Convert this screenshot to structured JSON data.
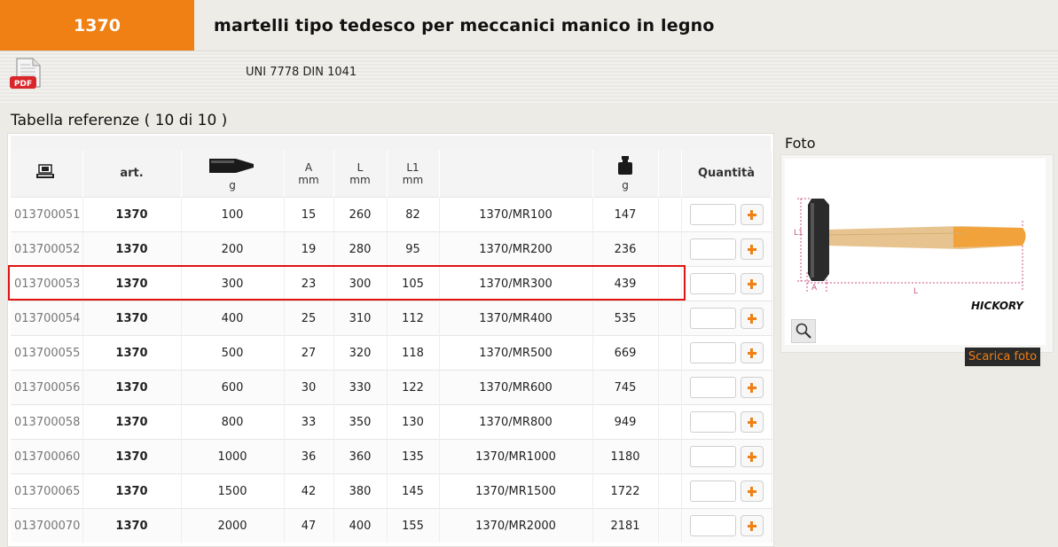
{
  "header": {
    "code": "1370",
    "title": "martelli tipo tedesco per meccanici manico in legno"
  },
  "subbar": {
    "pdf_icon": "pdf-icon",
    "norm": "UNI 7778 DIN 1041"
  },
  "table": {
    "title": "Tabella referenze ( 10 di 10 )",
    "headers": {
      "art": "art.",
      "weight_unit": "g",
      "a": "A",
      "a_unit": "mm",
      "l": "L",
      "l_unit": "mm",
      "l1": "L1",
      "l1_unit": "mm",
      "mass_unit": "g",
      "qty": "Quantità"
    },
    "rows": [
      {
        "code": "013700051",
        "art": "1370",
        "weight": "100",
        "a": "15",
        "l": "260",
        "l1": "82",
        "ref": "1370/MR100",
        "mass": "147"
      },
      {
        "code": "013700052",
        "art": "1370",
        "weight": "200",
        "a": "19",
        "l": "280",
        "l1": "95",
        "ref": "1370/MR200",
        "mass": "236"
      },
      {
        "code": "013700053",
        "art": "1370",
        "weight": "300",
        "a": "23",
        "l": "300",
        "l1": "105",
        "ref": "1370/MR300",
        "mass": "439"
      },
      {
        "code": "013700054",
        "art": "1370",
        "weight": "400",
        "a": "25",
        "l": "310",
        "l1": "112",
        "ref": "1370/MR400",
        "mass": "535"
      },
      {
        "code": "013700055",
        "art": "1370",
        "weight": "500",
        "a": "27",
        "l": "320",
        "l1": "118",
        "ref": "1370/MR500",
        "mass": "669"
      },
      {
        "code": "013700056",
        "art": "1370",
        "weight": "600",
        "a": "30",
        "l": "330",
        "l1": "122",
        "ref": "1370/MR600",
        "mass": "745"
      },
      {
        "code": "013700058",
        "art": "1370",
        "weight": "800",
        "a": "33",
        "l": "350",
        "l1": "130",
        "ref": "1370/MR800",
        "mass": "949"
      },
      {
        "code": "013700060",
        "art": "1370",
        "weight": "1000",
        "a": "36",
        "l": "360",
        "l1": "135",
        "ref": "1370/MR1000",
        "mass": "1180"
      },
      {
        "code": "013700065",
        "art": "1370",
        "weight": "1500",
        "a": "42",
        "l": "380",
        "l1": "145",
        "ref": "1370/MR1500",
        "mass": "1722"
      },
      {
        "code": "013700070",
        "art": "1370",
        "weight": "2000",
        "a": "47",
        "l": "400",
        "l1": "155",
        "ref": "1370/MR2000",
        "mass": "2181"
      }
    ]
  },
  "photo": {
    "label": "Foto",
    "dim_a": "A",
    "dim_l": "L",
    "dim_l1": "L1",
    "brand": "HICKORY",
    "download": "Scarica foto"
  },
  "colors": {
    "accent": "#f07f14",
    "highlight": "#e01212"
  }
}
